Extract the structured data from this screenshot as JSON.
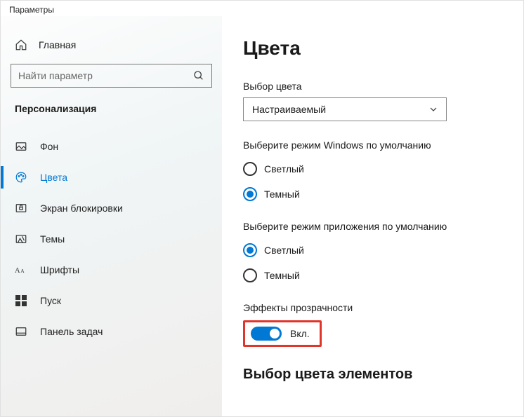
{
  "window": {
    "title": "Параметры"
  },
  "sidebar": {
    "home": "Главная",
    "search_placeholder": "Найти параметр",
    "section": "Персонализация",
    "items": [
      {
        "label": "Фон"
      },
      {
        "label": "Цвета"
      },
      {
        "label": "Экран блокировки"
      },
      {
        "label": "Темы"
      },
      {
        "label": "Шрифты"
      },
      {
        "label": "Пуск"
      },
      {
        "label": "Панель задач"
      }
    ]
  },
  "content": {
    "title": "Цвета",
    "color_picker": {
      "label": "Выбор цвета",
      "value": "Настраиваемый"
    },
    "windows_mode": {
      "label": "Выберите режим Windows по умолчанию",
      "options": [
        "Светлый",
        "Темный"
      ],
      "selected": "Темный"
    },
    "app_mode": {
      "label": "Выберите режим приложения по умолчанию",
      "options": [
        "Светлый",
        "Темный"
      ],
      "selected": "Светлый"
    },
    "transparency": {
      "label": "Эффекты прозрачности",
      "state_label": "Вкл."
    },
    "element_color_heading": "Выбор цвета элементов"
  }
}
